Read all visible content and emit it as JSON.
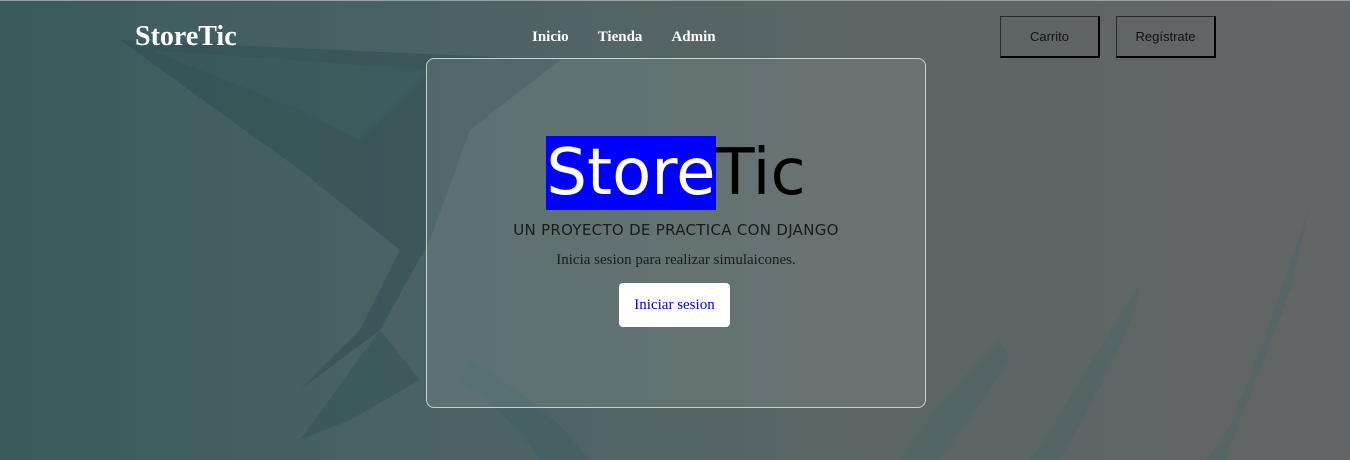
{
  "brand": "StoreTic",
  "nav": {
    "items": [
      "Inicio",
      "Tienda",
      "Admin"
    ]
  },
  "actions": {
    "cart_label": "Carrito",
    "register_label": "Regístrate"
  },
  "hero": {
    "title_highlight": "Store",
    "title_rest": "Tic",
    "subtitle": "UN PROYECTO DE PRACTICA CON DJANGO",
    "lead": "Inicia sesion para realizar simulaicones.",
    "login_label": "Iniciar sesion"
  },
  "colors": {
    "highlight": "#0000ff",
    "link": "#0000ee"
  }
}
